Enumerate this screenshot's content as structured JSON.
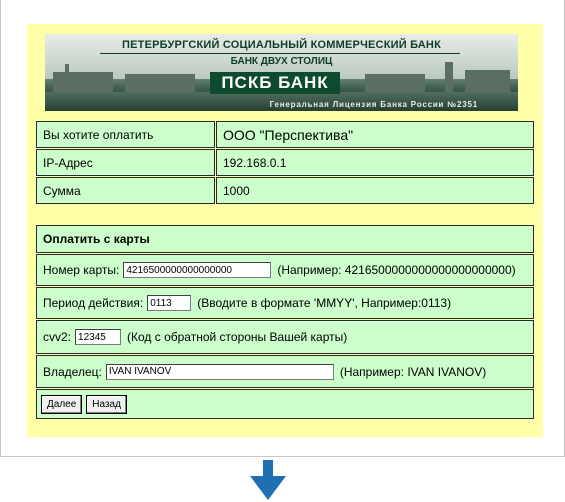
{
  "banner": {
    "bank_name": "ПЕТЕРБУРГСКИЙ СОЦИАЛЬНЫЙ КОММЕРЧЕСКИЙ БАНК",
    "slogan": "БАНК ДВУХ СТОЛИЦ",
    "logo_text": "ПСКБ БАНК",
    "license": "Генеральная Лицензия Банка России №2351"
  },
  "summary": {
    "payee_label": "Вы хотите оплатить",
    "payee_value": "ООО \"Перспектива\"",
    "ip_label": "IP-Адрес",
    "ip_value": "192.168.0.1",
    "amount_label": "Сумма",
    "amount_value": "1000"
  },
  "card_form": {
    "title": "Оплатить с карты",
    "card_number_label": "Номер карты:",
    "card_number_value": "4216500000000000000",
    "card_number_hint": "(Например: 4216500000000000000000000)",
    "expiry_label": "Период действия:",
    "expiry_value": "0113",
    "expiry_hint": "(Вводите в формате 'MMYY', Например:0113)",
    "cvv_label": "cvv2:",
    "cvv_value": "12345",
    "cvv_hint": "(Код с обратной стороны Вашей карты)",
    "owner_label": "Владелец:",
    "owner_value": "IVAN IVANOV",
    "owner_hint": "(Например: IVAN IVANOV)",
    "next_button": "Далее",
    "back_button": "Назад"
  },
  "colors": {
    "panel_background": "#ffffa8",
    "row_background": "#ccffcc",
    "arrow": "#1f6fb2"
  },
  "icons": {
    "down_arrow": "down-arrow-icon"
  }
}
